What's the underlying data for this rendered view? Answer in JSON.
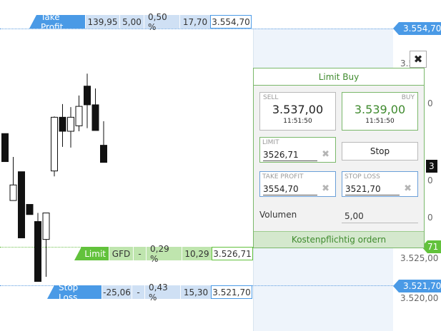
{
  "chart": {
    "y_axis": {
      "ticks": [
        "3.554,70",
        "3.525,00",
        "3.520,00"
      ],
      "partial_ticks": [
        "3.5",
        "0",
        "0",
        "0",
        "0"
      ]
    },
    "current_price_tag": "3",
    "limit_tag_tail": "71",
    "candle_ohlc": [
      {
        "o": 3541.2,
        "h": 3541.2,
        "l": 3537.6,
        "c": 3537.6
      },
      {
        "o": 3532.6,
        "h": 3538.2,
        "l": 3532.6,
        "c": 3534.6
      },
      {
        "o": 3536.3,
        "h": 3536.3,
        "l": 3527.8,
        "c": 3527.8
      },
      {
        "o": 3532.1,
        "h": 3532.1,
        "l": 3530.8,
        "c": 3530.8
      },
      {
        "o": 3529.9,
        "h": 3531.0,
        "l": 3522.2,
        "c": 3522.2
      },
      {
        "o": 3527.6,
        "h": 3531.0,
        "l": 3522.8,
        "c": 3531.0
      },
      {
        "o": 3536.4,
        "h": 3543.4,
        "l": 3535.7,
        "c": 3543.3
      },
      {
        "o": 3543.3,
        "h": 3545.0,
        "l": 3539.5,
        "c": 3541.5
      },
      {
        "o": 3541.5,
        "h": 3544.6,
        "l": 3539.4,
        "c": 3543.3
      },
      {
        "o": 3542.2,
        "h": 3546.1,
        "l": 3541.5,
        "c": 3544.7
      },
      {
        "o": 3547.3,
        "h": 3548.9,
        "l": 3541.9,
        "c": 3544.9
      },
      {
        "o": 3544.9,
        "h": 3547.0,
        "l": 3542.0,
        "c": 3541.6
      },
      {
        "o": 3539.7,
        "h": 3542.8,
        "l": 3537.5,
        "c": 3537.5
      }
    ]
  },
  "take_profit_bar": {
    "label": "Take Profit",
    "cells": [
      "139,95",
      "5,00",
      "0,50 %",
      "17,70"
    ],
    "price": "3.554,70",
    "axis_tag": "3.554,70"
  },
  "limit_bar": {
    "label": "Limit",
    "cells": [
      "GFD",
      "-",
      "0,29 %",
      "10,29"
    ],
    "price": "3.526,71"
  },
  "stop_loss_bar": {
    "label": "Stop Loss",
    "cells": [
      "-25,06",
      "-",
      "0,43 %",
      "15,30"
    ],
    "price": "3.521,70",
    "axis_tag": "3.521,70"
  },
  "dialog": {
    "close_icon": "✖",
    "title": "Limit Buy",
    "sell": {
      "label": "SELL",
      "price": "3.537,00",
      "time": "11:51:50"
    },
    "buy": {
      "label": "BUY",
      "price": "3.539,00",
      "time": "11:51:50"
    },
    "limit": {
      "label": "LIMIT",
      "value": "3526,71"
    },
    "stop_button": "Stop",
    "take_profit": {
      "label": "TAKE PROFIT",
      "value": "3554,70"
    },
    "stop_loss": {
      "label": "STOP LOSS",
      "value": "3521,70"
    },
    "clear_icon": "✖",
    "volume_label": "Volumen",
    "volume_value": "5,00",
    "order_button": "Kostenpflichtig ordern"
  },
  "colors": {
    "blue_accent": "#4a9ae6",
    "green_accent": "#62c23c",
    "dialog_border": "#7ab86a"
  }
}
